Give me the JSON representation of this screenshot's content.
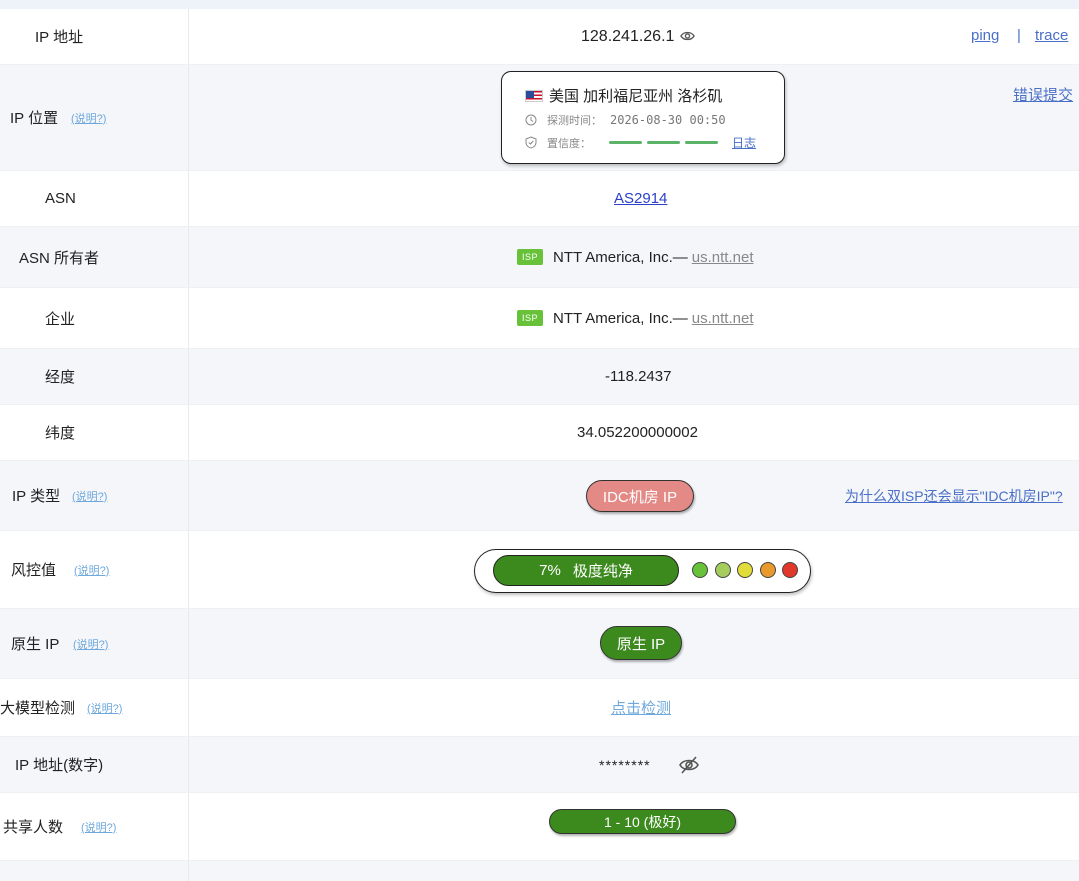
{
  "rows": {
    "ip": {
      "label": "IP 地址",
      "value": "128.241.26.1",
      "ping": "ping",
      "sep": "|",
      "trace": "trace"
    },
    "location": {
      "label": "IP 位置",
      "help": "(说明?)",
      "place": "美国 加利福尼亚州 洛杉矶",
      "time_label": "探测时间：",
      "time_value": "2026-08-30 00:50",
      "confidence_label": "置信度：",
      "log_link": "日志",
      "report": "错误提交",
      "confidence_level": 3
    },
    "asn": {
      "label": "ASN",
      "value": "AS2914"
    },
    "asn_owner": {
      "label": "ASN 所有者",
      "tag": "ISP",
      "name": "NTT America, Inc.—",
      "domain": "us.ntt.net"
    },
    "company": {
      "label": "企业",
      "tag": "ISP",
      "name": "NTT America, Inc.—",
      "domain": "us.ntt.net"
    },
    "longitude": {
      "label": "经度",
      "value": "-118.2437"
    },
    "latitude": {
      "label": "纬度",
      "value": "34.052200000002"
    },
    "ip_type": {
      "label": "IP 类型",
      "help": "(说明?)",
      "value": "IDC机房 IP",
      "why": "为什么双ISP还会显示\"IDC机房IP\"?"
    },
    "risk": {
      "label": "风控值",
      "help": "(说明?)",
      "percent": "7%",
      "text": "极度纯净",
      "dots": [
        "#67c23a",
        "#a5cd5e",
        "#e0dc3a",
        "#e89a2c",
        "#e0392b"
      ]
    },
    "native": {
      "label": "原生 IP",
      "help": "(说明?)",
      "value": "原生 IP"
    },
    "llm": {
      "label": "大模型检测",
      "help": "(说明?)",
      "value": "点击检测"
    },
    "ip_number": {
      "label": "IP 地址(数字)",
      "value": "********"
    },
    "shared": {
      "label": "共享人数",
      "help": "(说明?)",
      "value": "1 - 10 (极好)"
    }
  },
  "colors": {
    "link": "#4a6fc7",
    "green": "#3c8a1e",
    "idc": "#e48a86",
    "isp": "#67c23a"
  }
}
